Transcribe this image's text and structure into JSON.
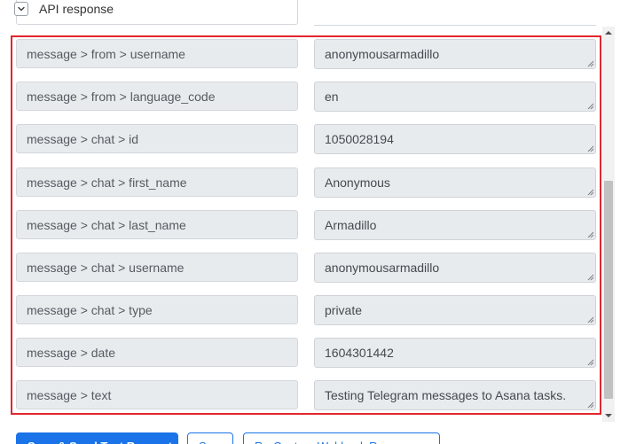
{
  "header": {
    "toggle_icon": "chevron-down-icon",
    "title": "API response"
  },
  "fields": [
    {
      "key": "message > from > username",
      "value": "anonymousarmadillo"
    },
    {
      "key": "message > from > language_code",
      "value": "en"
    },
    {
      "key": "message > chat > id",
      "value": "1050028194"
    },
    {
      "key": "message > chat > first_name",
      "value": "Anonymous"
    },
    {
      "key": "message > chat > last_name",
      "value": "Armadillo"
    },
    {
      "key": "message > chat > username",
      "value": "anonymousarmadillo"
    },
    {
      "key": "message > chat > type",
      "value": "private"
    },
    {
      "key": "message > date",
      "value": "1604301442"
    },
    {
      "key": "message > text",
      "value": "Testing Telegram messages to Asana tasks."
    }
  ],
  "buttons": {
    "primary": "Save & Send Test Request",
    "save": "Save",
    "rerun": "Re-Capture Webhook Response"
  },
  "colors": {
    "highlight": "#e2262e",
    "field_bg": "#e8ebee",
    "accent": "#1a73e8"
  }
}
